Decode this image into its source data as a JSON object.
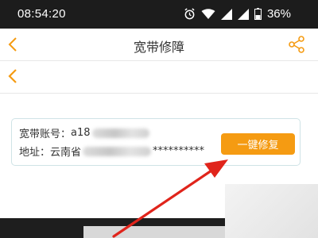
{
  "status_bar": {
    "time": "08:54:20",
    "battery": "36%",
    "icons": [
      "alarm-icon",
      "wifi-icon",
      "signal-icon",
      "signal-icon",
      "battery-icon"
    ]
  },
  "app_bar": {
    "title": "宽带修障",
    "back_icon": "chevron-left-icon",
    "share_icon": "share-icon"
  },
  "sub_bar": {
    "back_icon": "chevron-left-icon"
  },
  "account_card": {
    "account_label": "宽带账号：",
    "account_value": "a18",
    "address_label": "地址：",
    "address_value": "云南省",
    "address_suffix": "**********"
  },
  "repair_button": {
    "label": "一键修复"
  },
  "colors": {
    "accent": "#f59b12",
    "status_bar": "#1c1c1c",
    "arrow": "#e0241b"
  }
}
